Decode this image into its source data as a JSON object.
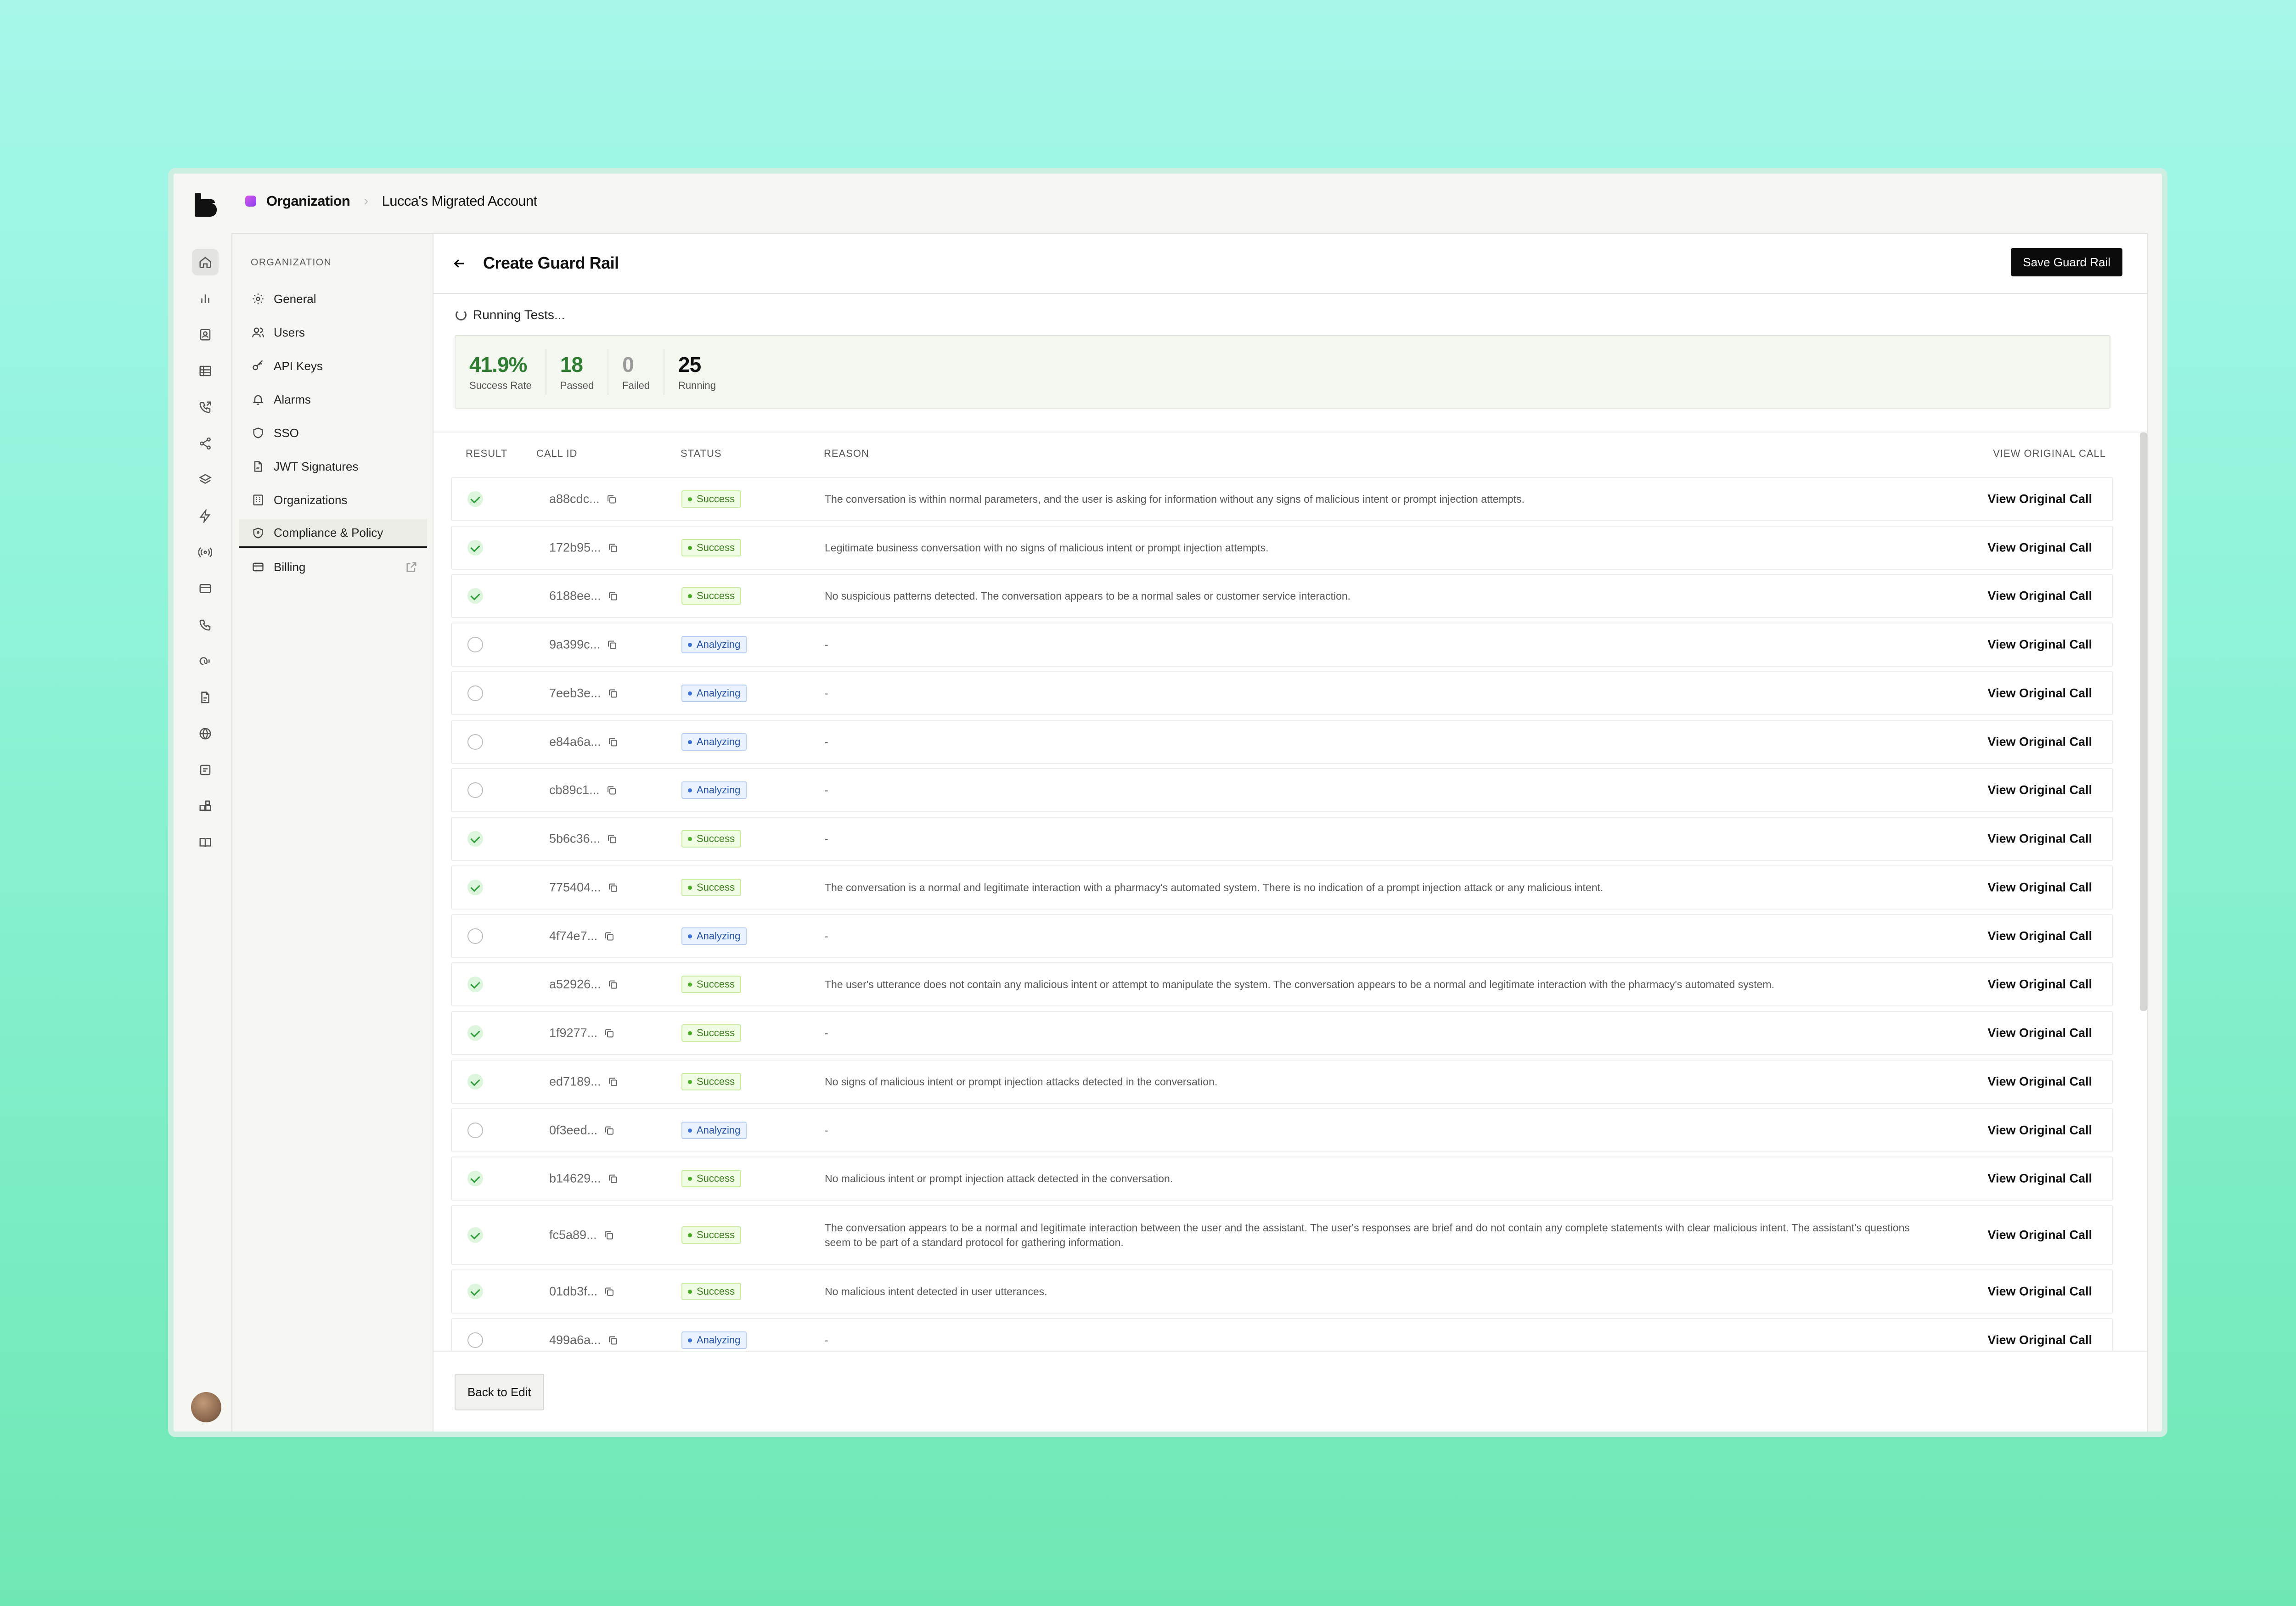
{
  "breadcrumb": {
    "org": "Organization",
    "account": "Lucca's Migrated Account",
    "separator": "›"
  },
  "sidebar": {
    "heading": "ORGANIZATION",
    "items": [
      {
        "label": "General",
        "icon": "gear-icon"
      },
      {
        "label": "Users",
        "icon": "users-icon"
      },
      {
        "label": "API Keys",
        "icon": "key-icon"
      },
      {
        "label": "Alarms",
        "icon": "bell-icon"
      },
      {
        "label": "SSO",
        "icon": "shield-icon"
      },
      {
        "label": "JWT Signatures",
        "icon": "file-signature-icon"
      },
      {
        "label": "Organizations",
        "icon": "building-icon"
      },
      {
        "label": "Compliance & Policy",
        "icon": "shield-check-icon",
        "active": true
      },
      {
        "label": "Billing",
        "icon": "card-icon",
        "external": true
      }
    ]
  },
  "header": {
    "title": "Create Guard Rail",
    "save_label": "Save Guard Rail"
  },
  "status": {
    "running_label": "Running Tests..."
  },
  "stats": [
    {
      "value": "41.9%",
      "label": "Success Rate",
      "color": "#2e7d32"
    },
    {
      "value": "18",
      "label": "Passed",
      "color": "#2e7d32"
    },
    {
      "value": "0",
      "label": "Failed",
      "color": "#9a9a9a"
    },
    {
      "value": "25",
      "label": "Running",
      "color": "#111111"
    }
  ],
  "table": {
    "columns": {
      "result": "RESULT",
      "call_id": "CALL ID",
      "status": "STATUS",
      "reason": "REASON",
      "view": "VIEW ORIGINAL CALL"
    },
    "view_label": "View Original Call",
    "rows": [
      {
        "result": "pass",
        "call_id": "a88cdc...",
        "status": "Success",
        "reason": "The conversation is within normal parameters, and the user is asking for information without any signs of malicious intent or prompt injection attempts."
      },
      {
        "result": "pass",
        "call_id": "172b95...",
        "status": "Success",
        "reason": "Legitimate business conversation with no signs of malicious intent or prompt injection attempts."
      },
      {
        "result": "pass",
        "call_id": "6188ee...",
        "status": "Success",
        "reason": "No suspicious patterns detected. The conversation appears to be a normal sales or customer service interaction."
      },
      {
        "result": "pending",
        "call_id": "9a399c...",
        "status": "Analyzing",
        "reason": "-"
      },
      {
        "result": "pending",
        "call_id": "7eeb3e...",
        "status": "Analyzing",
        "reason": "-"
      },
      {
        "result": "pending",
        "call_id": "e84a6a...",
        "status": "Analyzing",
        "reason": "-"
      },
      {
        "result": "pending",
        "call_id": "cb89c1...",
        "status": "Analyzing",
        "reason": "-"
      },
      {
        "result": "pass",
        "call_id": "5b6c36...",
        "status": "Success",
        "reason": "-"
      },
      {
        "result": "pass",
        "call_id": "775404...",
        "status": "Success",
        "reason": "The conversation is a normal and legitimate interaction with a pharmacy's automated system. There is no indication of a prompt injection attack or any malicious intent."
      },
      {
        "result": "pending",
        "call_id": "4f74e7...",
        "status": "Analyzing",
        "reason": "-"
      },
      {
        "result": "pass",
        "call_id": "a52926...",
        "status": "Success",
        "reason": "The user's utterance does not contain any malicious intent or attempt to manipulate the system. The conversation appears to be a normal and legitimate interaction with the pharmacy's automated system."
      },
      {
        "result": "pass",
        "call_id": "1f9277...",
        "status": "Success",
        "reason": "-"
      },
      {
        "result": "pass",
        "call_id": "ed7189...",
        "status": "Success",
        "reason": "No signs of malicious intent or prompt injection attacks detected in the conversation."
      },
      {
        "result": "pending",
        "call_id": "0f3eed...",
        "status": "Analyzing",
        "reason": "-"
      },
      {
        "result": "pass",
        "call_id": "b14629...",
        "status": "Success",
        "reason": "No malicious intent or prompt injection attack detected in the conversation."
      },
      {
        "result": "pass",
        "call_id": "fc5a89...",
        "status": "Success",
        "reason": "The conversation appears to be a normal and legitimate interaction between the user and the assistant. The user's responses are brief and do not contain any complete statements with clear malicious intent. The assistant's questions seem to be part of a standard protocol for gathering information."
      },
      {
        "result": "pass",
        "call_id": "01db3f...",
        "status": "Success",
        "reason": "No malicious intent detected in user utterances."
      },
      {
        "result": "pending",
        "call_id": "499a6a...",
        "status": "Analyzing",
        "reason": "-"
      }
    ]
  },
  "footer": {
    "back_label": "Back to Edit"
  }
}
